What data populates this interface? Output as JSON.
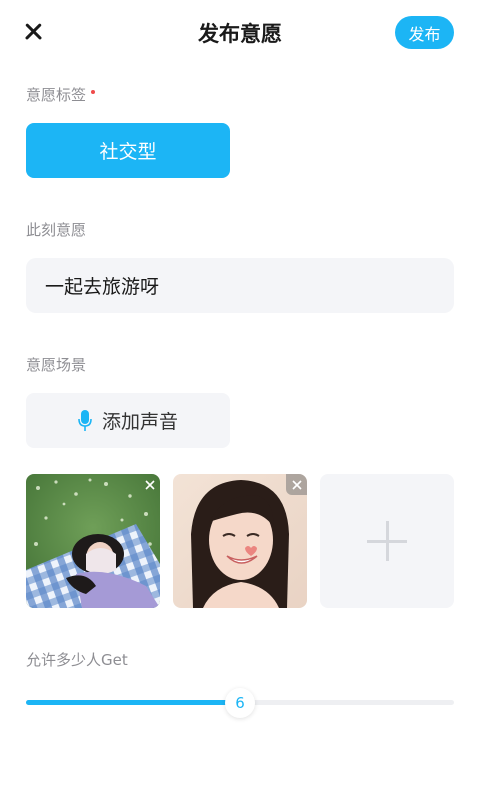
{
  "header": {
    "title": "发布意愿",
    "publish_label": "发布"
  },
  "tags": {
    "label": "意愿标签",
    "selected": "社交型"
  },
  "wish": {
    "label": "此刻意愿",
    "value": "一起去旅游呀"
  },
  "scene": {
    "label": "意愿场景",
    "add_sound_label": "添加声音",
    "photos": [
      {
        "desc": "girl-covering-face-on-picnic-blanket"
      },
      {
        "desc": "smiling-girl-portrait"
      }
    ]
  },
  "allow": {
    "label": "允许多少人Get",
    "value": "6",
    "fill_fraction": 0.5
  },
  "colors": {
    "accent": "#1cb5f5",
    "required_dot": "#ef4b4b",
    "field_bg": "#f4f5f8"
  }
}
